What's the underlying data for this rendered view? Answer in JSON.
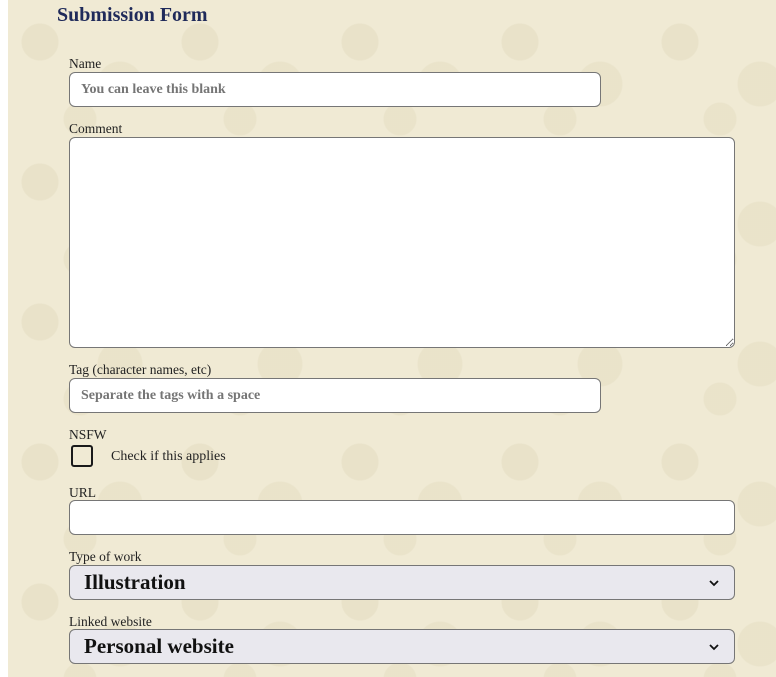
{
  "form": {
    "title": "Submission Form",
    "name": {
      "label": "Name",
      "placeholder": "You can leave this blank",
      "value": ""
    },
    "comment": {
      "label": "Comment",
      "value": ""
    },
    "tags": {
      "label": "Tag (character names, etc)",
      "placeholder": "Separate the tags with a space",
      "value": ""
    },
    "nsfw": {
      "label": "NSFW",
      "checkbox_label": "Check if this applies",
      "checked": false
    },
    "url": {
      "label": "URL",
      "value": ""
    },
    "type_of_work": {
      "label": "Type of work",
      "selected": "Illustration"
    },
    "linked_website": {
      "label": "Linked website",
      "selected": "Personal website"
    }
  },
  "colors": {
    "background": "#f0ead4",
    "title": "#1f2a5a",
    "select_bg": "#e9e8ee"
  },
  "icons": {
    "select_arrow": "chevron-down-icon"
  }
}
